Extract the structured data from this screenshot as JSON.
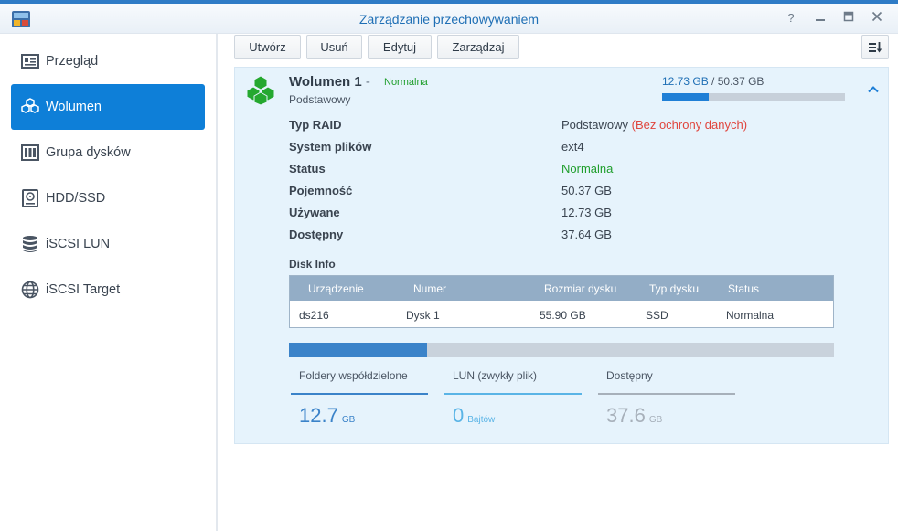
{
  "window": {
    "title": "Zarządzanie przechowywaniem"
  },
  "sidebar": {
    "items": [
      {
        "label": "Przegląd",
        "icon": "overview-icon"
      },
      {
        "label": "Wolumen",
        "icon": "cubes-icon",
        "active": true
      },
      {
        "label": "Grupa dysków",
        "icon": "disk-group-icon"
      },
      {
        "label": "HDD/SSD",
        "icon": "hdd-icon"
      },
      {
        "label": "iSCSI LUN",
        "icon": "database-icon"
      },
      {
        "label": "iSCSI Target",
        "icon": "globe-icon"
      }
    ]
  },
  "toolbar": {
    "create": "Utwórz",
    "remove": "Usuń",
    "edit": "Edytuj",
    "manage": "Zarządzaj"
  },
  "volume": {
    "name": "Wolumen 1",
    "dash": "-",
    "status": "Normalna",
    "type": "Podstawowy",
    "used": "12.73 GB",
    "separator": "/",
    "total": "50.37 GB",
    "used_fraction": 0.253
  },
  "properties": [
    {
      "label": "Typ RAID",
      "value": "Podstawowy",
      "extra": "(Bez ochrony danych)"
    },
    {
      "label": "System plików",
      "value": "ext4"
    },
    {
      "label": "Status",
      "value": "Normalna"
    },
    {
      "label": "Pojemność",
      "value": "50.37 GB"
    },
    {
      "label": "Używane",
      "value": "12.73 GB"
    },
    {
      "label": "Dostępny",
      "value": "37.64 GB"
    }
  ],
  "disk_info": {
    "title": "Disk Info",
    "columns": [
      "Urządzenie",
      "Numer",
      "Rozmiar dysku",
      "Typ dysku",
      "Status"
    ],
    "rows": [
      [
        "ds216",
        "Dysk 1",
        "55.90 GB",
        "SSD",
        "Normalna"
      ]
    ]
  },
  "distribution": {
    "shared_fraction": 0.253,
    "categories": [
      {
        "label": "Foldery współdzielone",
        "value": "12.7",
        "unit": "GB"
      },
      {
        "label": "LUN (zwykły plik)",
        "value": "0",
        "unit": "Bajtów"
      },
      {
        "label": "Dostępny",
        "value": "37.6",
        "unit": "GB"
      }
    ]
  },
  "colors": {
    "accent": "#0e7fd8",
    "ok": "#1f9e2c",
    "warn": "#e0453d",
    "shared": "#3b83c9",
    "lun": "#5ab4e6",
    "free": "#a7b0ba"
  }
}
